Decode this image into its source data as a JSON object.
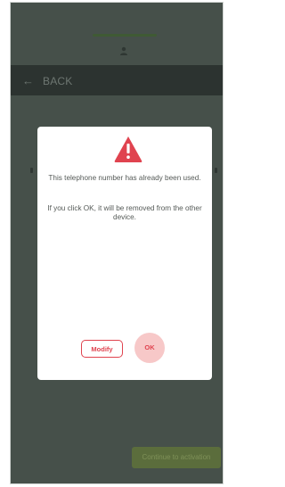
{
  "header": {
    "user_icon": "user-icon"
  },
  "nav": {
    "back_icon": "back-arrow-icon",
    "back_label": "BACK"
  },
  "dialog": {
    "icon": "warning-icon",
    "message_1": "This telephone number has already been used.",
    "message_2": "If you click OK, it will be removed from the other device.",
    "modify_label": "Modify",
    "ok_label": "OK",
    "accent_color": "#e0434f"
  },
  "footer": {
    "action_label": "Continue to activation"
  }
}
